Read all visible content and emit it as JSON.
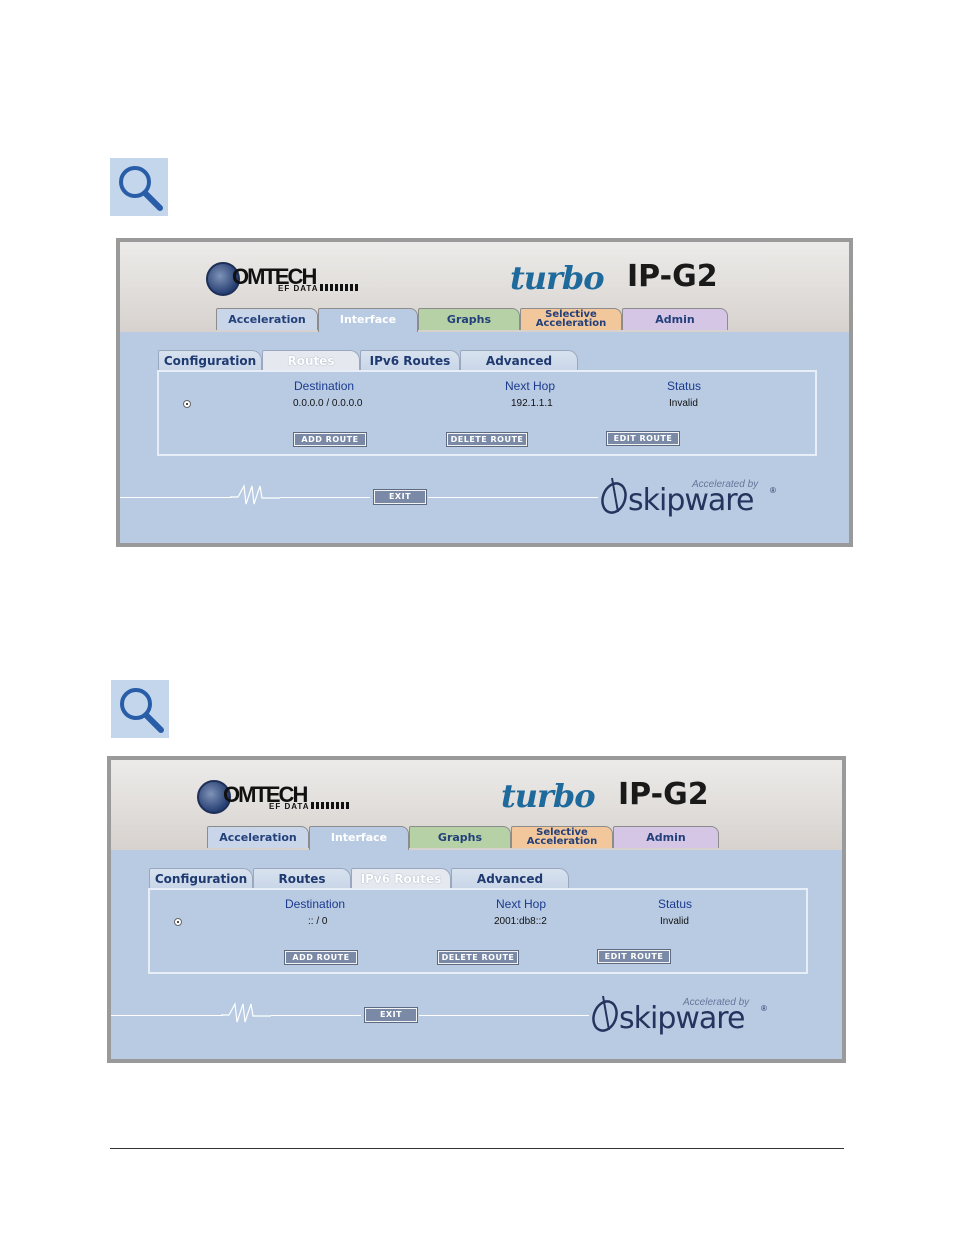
{
  "icons": {
    "magnifier": "magnifier-icon"
  },
  "colors": {
    "panel_bg": "#b9cbe3",
    "header_text": "#1b3a8e",
    "turbo_blue": "#1f6a9c"
  },
  "screens": [
    {
      "logo": {
        "brand": "OMTECH",
        "sub": "EF DATA"
      },
      "product": {
        "turbo": "turbo",
        "model": "IP-G2"
      },
      "main_tabs": [
        "Acceleration",
        "Interface",
        "Graphs",
        "Selective",
        "Acceleration",
        "Admin"
      ],
      "sub_tabs": [
        "Configuration",
        "Routes",
        "IPv6 Routes",
        "Advanced"
      ],
      "active_sub_tab": "Routes",
      "columns": [
        "Destination",
        "Next Hop",
        "Status"
      ],
      "rows": [
        {
          "destination": "0.0.0.0 / 0.0.0.0",
          "next_hop": "192.1.1.1",
          "status": "Invalid",
          "selected": true
        }
      ],
      "buttons": {
        "add": "ADD ROUTE",
        "delete": "DELETE ROUTE",
        "edit": "EDIT ROUTE",
        "exit": "EXIT"
      },
      "skipware": {
        "accelerated_by": "Accelerated by",
        "name": "skipware",
        "reg": "®"
      }
    },
    {
      "logo": {
        "brand": "OMTECH",
        "sub": "EF DATA"
      },
      "product": {
        "turbo": "turbo",
        "model": "IP-G2"
      },
      "main_tabs": [
        "Acceleration",
        "Interface",
        "Graphs",
        "Selective",
        "Acceleration",
        "Admin"
      ],
      "sub_tabs": [
        "Configuration",
        "Routes",
        "IPv6 Routes",
        "Advanced"
      ],
      "active_sub_tab": "IPv6 Routes",
      "columns": [
        "Destination",
        "Next Hop",
        "Status"
      ],
      "rows": [
        {
          "destination": ":: / 0",
          "next_hop": "2001:db8::2",
          "status": "Invalid",
          "selected": true
        }
      ],
      "buttons": {
        "add": "ADD ROUTE",
        "delete": "DELETE ROUTE",
        "edit": "EDIT ROUTE",
        "exit": "EXIT"
      },
      "skipware": {
        "accelerated_by": "Accelerated by",
        "name": "skipware",
        "reg": "®"
      }
    }
  ]
}
